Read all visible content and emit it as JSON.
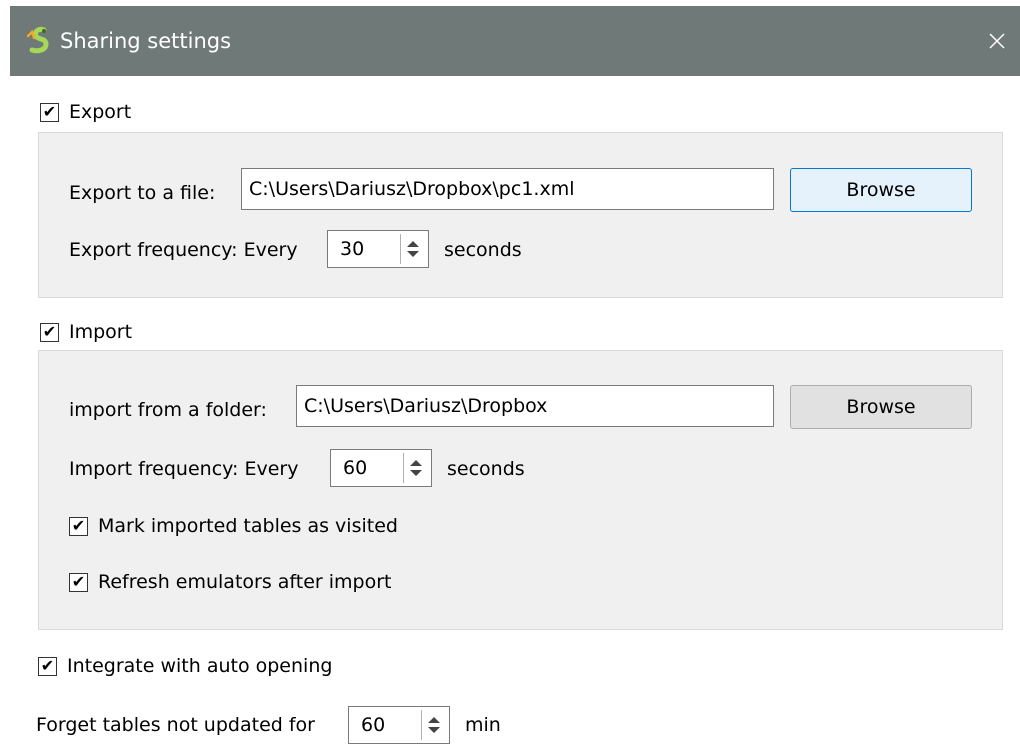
{
  "window": {
    "title": "Sharing settings",
    "close_glyph": "✕"
  },
  "export": {
    "checkbox_label": "Export",
    "checked": true,
    "file_label": "Export to a file:",
    "file_value": "C:\\Users\\Dariusz\\Dropbox\\pc1.xml",
    "browse_label": "Browse",
    "frequency_label": "Export frequency: Every",
    "frequency_value": "30",
    "frequency_unit": "seconds"
  },
  "import": {
    "checkbox_label": "Import",
    "checked": true,
    "folder_label": "import from a folder:",
    "folder_value": "C:\\Users\\Dariusz\\Dropbox",
    "browse_label": "Browse",
    "frequency_label": "Import frequency: Every",
    "frequency_value": "60",
    "frequency_unit": "seconds",
    "mark_visited_label": "Mark imported tables as visited",
    "mark_visited_checked": true,
    "refresh_label": "Refresh emulators after import",
    "refresh_checked": true
  },
  "auto_open": {
    "label": "Integrate with auto opening",
    "checked": true
  },
  "forget": {
    "label": "Forget tables not updated for",
    "value": "60",
    "unit": "min"
  },
  "check_glyph": "✔",
  "colors": {
    "titlebar": "#6f7a78",
    "group_bg": "#f0f0f0",
    "focus_border": "#0078d7",
    "icon_green": "#8bc34a"
  }
}
